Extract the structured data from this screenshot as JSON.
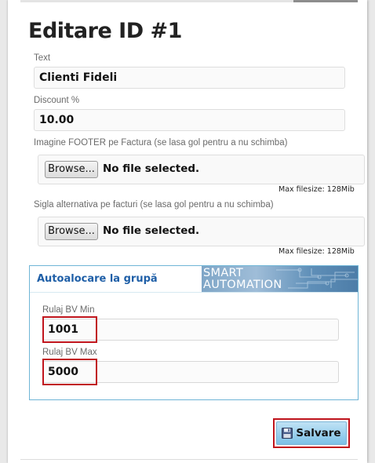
{
  "page": {
    "title": "Editare ID #1"
  },
  "form": {
    "text": {
      "label": "Text",
      "value": "Clienti Fideli"
    },
    "discount": {
      "label": "Discount %",
      "value": "10.00"
    },
    "footer_image": {
      "label": "Imagine FOOTER pe Factura (se lasa gol pentru a nu schimba)",
      "browse_label": "Browse...",
      "status": "No file selected.",
      "max_filesize": "Max filesize: 128Mib"
    },
    "alt_logo": {
      "label": "Sigla alternativa pe facturi (se lasa gol pentru a nu schimba)",
      "browse_label": "Browse...",
      "status": "No file selected.",
      "max_filesize": "Max filesize: 128Mib"
    },
    "auto_group": {
      "title": "Autoalocare la grupă",
      "logo_line1": "SMART",
      "logo_line2": "AUTOMATION",
      "min": {
        "label": "Rulaj BV Min",
        "value": "1001"
      },
      "max": {
        "label": "Rulaj BV Max",
        "value": "5000"
      }
    },
    "save_label": "Salvare"
  },
  "colors": {
    "highlight": "#c0141c",
    "group_border": "#6fb5d6",
    "group_title": "#1f5fa7",
    "save_button": "#7cc0e6"
  },
  "icons": {
    "save": "floppy-disk-icon"
  }
}
